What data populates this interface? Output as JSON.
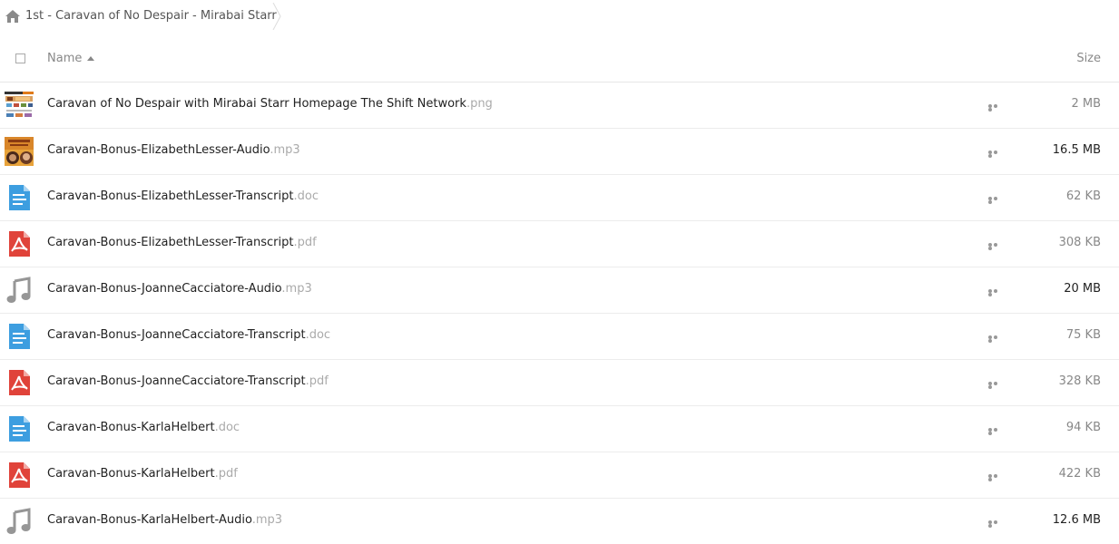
{
  "breadcrumb": {
    "folder_name": "1st - Caravan of No Despair - Mirabai Starr"
  },
  "header": {
    "name_label": "Name",
    "size_label": "Size"
  },
  "files": [
    {
      "name": "Caravan of No Despair with Mirabai Starr Homepage The Shift Network",
      "ext": ".png",
      "size": "2 MB",
      "icon": "image-thumbnail-icon"
    },
    {
      "name": "Caravan-Bonus-ElizabethLesser-Audio",
      "ext": ".mp3",
      "size": "16.5 MB",
      "icon": "album-art-thumbnail-icon"
    },
    {
      "name": "Caravan-Bonus-ElizabethLesser-Transcript",
      "ext": ".doc",
      "size": "62 KB",
      "icon": "document-icon"
    },
    {
      "name": "Caravan-Bonus-ElizabethLesser-Transcript",
      "ext": ".pdf",
      "size": "308 KB",
      "icon": "pdf-icon"
    },
    {
      "name": "Caravan-Bonus-JoanneCacciatore-Audio",
      "ext": ".mp3",
      "size": "20 MB",
      "icon": "music-note-icon"
    },
    {
      "name": "Caravan-Bonus-JoanneCacciatore-Transcript",
      "ext": ".doc",
      "size": "75 KB",
      "icon": "document-icon"
    },
    {
      "name": "Caravan-Bonus-JoanneCacciatore-Transcript",
      "ext": ".pdf",
      "size": "328 KB",
      "icon": "pdf-icon"
    },
    {
      "name": "Caravan-Bonus-KarlaHelbert",
      "ext": ".doc",
      "size": "94 KB",
      "icon": "document-icon"
    },
    {
      "name": "Caravan-Bonus-KarlaHelbert",
      "ext": ".pdf",
      "size": "422 KB",
      "icon": "pdf-icon"
    },
    {
      "name": "Caravan-Bonus-KarlaHelbert-Audio",
      "ext": ".mp3",
      "size": "12.6 MB",
      "icon": "music-note-icon"
    }
  ],
  "colors": {
    "doc_blue": "#3d9ee0",
    "pdf_red": "#e0433a",
    "audio_grey": "#969696"
  }
}
